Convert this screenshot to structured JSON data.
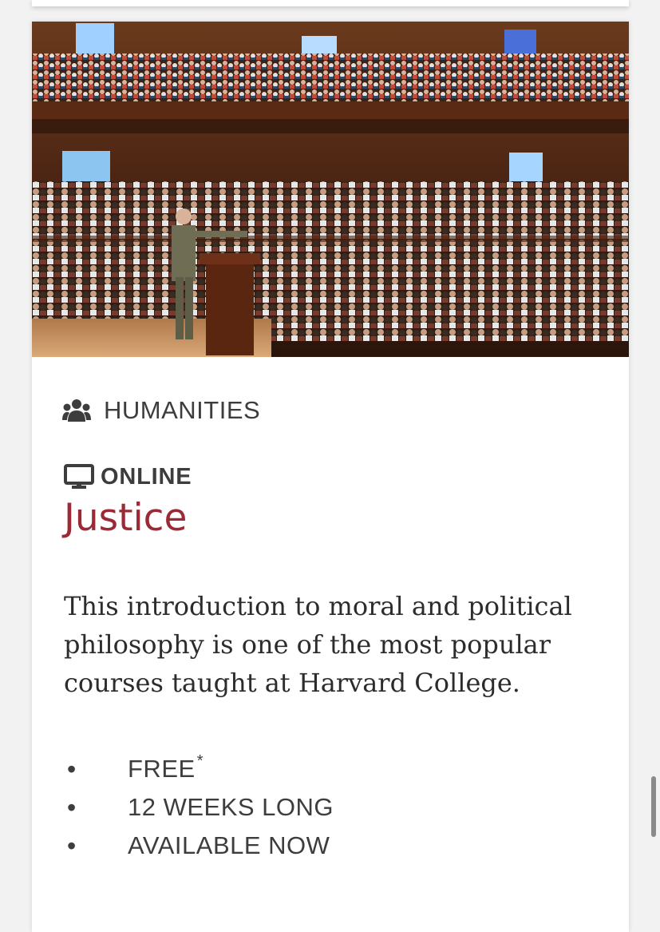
{
  "course": {
    "image_alt": "Lecturer speaking to a packed lecture hall",
    "category": "HUMANITIES",
    "category_icon": "users-icon",
    "format": "ONLINE",
    "format_icon": "monitor-icon",
    "title": "Justice",
    "description": "This introduction to moral and political philosophy is one of the most popular courses taught at Harvard College.",
    "details": [
      {
        "text": "FREE",
        "note": "*"
      },
      {
        "text": "12 WEEKS LONG",
        "note": ""
      },
      {
        "text": "AVAILABLE NOW",
        "note": ""
      }
    ],
    "colors": {
      "title": "#9b2a36",
      "text": "#3d3d3d"
    }
  }
}
